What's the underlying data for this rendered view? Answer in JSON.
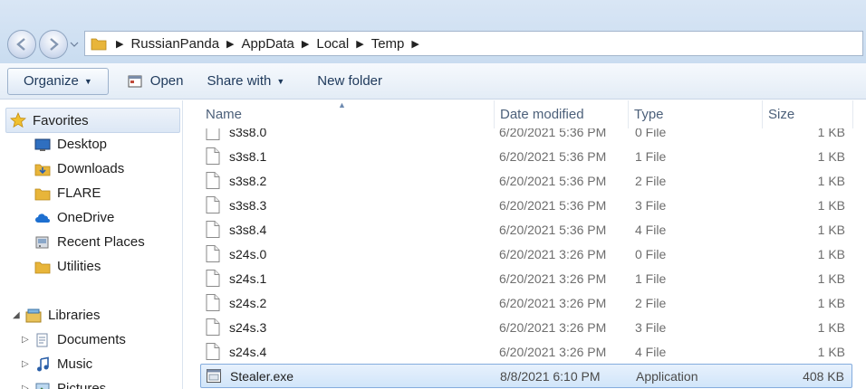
{
  "breadcrumb": {
    "items": [
      "RussianPanda",
      "AppData",
      "Local",
      "Temp"
    ]
  },
  "toolbar": {
    "organize_label": "Organize",
    "open_label": "Open",
    "share_label": "Share with",
    "newfolder_label": "New folder"
  },
  "navpane": {
    "favorites_label": "Favorites",
    "favorites": [
      "Desktop",
      "Downloads",
      "FLARE",
      "OneDrive",
      "Recent Places",
      "Utilities"
    ],
    "libraries_label": "Libraries",
    "libraries": [
      "Documents",
      "Music",
      "Pictures"
    ]
  },
  "columns": {
    "name": "Name",
    "date": "Date modified",
    "type": "Type",
    "size": "Size"
  },
  "files": [
    {
      "name": "s3s8.0",
      "date": "6/20/2021 5:36 PM",
      "type": "0 File",
      "size": "1 KB"
    },
    {
      "name": "s3s8.1",
      "date": "6/20/2021 5:36 PM",
      "type": "1 File",
      "size": "1 KB"
    },
    {
      "name": "s3s8.2",
      "date": "6/20/2021 5:36 PM",
      "type": "2 File",
      "size": "1 KB"
    },
    {
      "name": "s3s8.3",
      "date": "6/20/2021 5:36 PM",
      "type": "3 File",
      "size": "1 KB"
    },
    {
      "name": "s3s8.4",
      "date": "6/20/2021 5:36 PM",
      "type": "4 File",
      "size": "1 KB"
    },
    {
      "name": "s24s.0",
      "date": "6/20/2021 3:26 PM",
      "type": "0 File",
      "size": "1 KB"
    },
    {
      "name": "s24s.1",
      "date": "6/20/2021 3:26 PM",
      "type": "1 File",
      "size": "1 KB"
    },
    {
      "name": "s24s.2",
      "date": "6/20/2021 3:26 PM",
      "type": "2 File",
      "size": "1 KB"
    },
    {
      "name": "s24s.3",
      "date": "6/20/2021 3:26 PM",
      "type": "3 File",
      "size": "1 KB"
    },
    {
      "name": "s24s.4",
      "date": "6/20/2021 3:26 PM",
      "type": "4 File",
      "size": "1 KB"
    },
    {
      "name": "Stealer.exe",
      "date": "8/8/2021 6:10 PM",
      "type": "Application",
      "size": "408 KB",
      "selected": true
    }
  ],
  "colors": {
    "accent": "#1e395b",
    "selection_border": "#84acdd",
    "folder": "#e8b53a"
  }
}
